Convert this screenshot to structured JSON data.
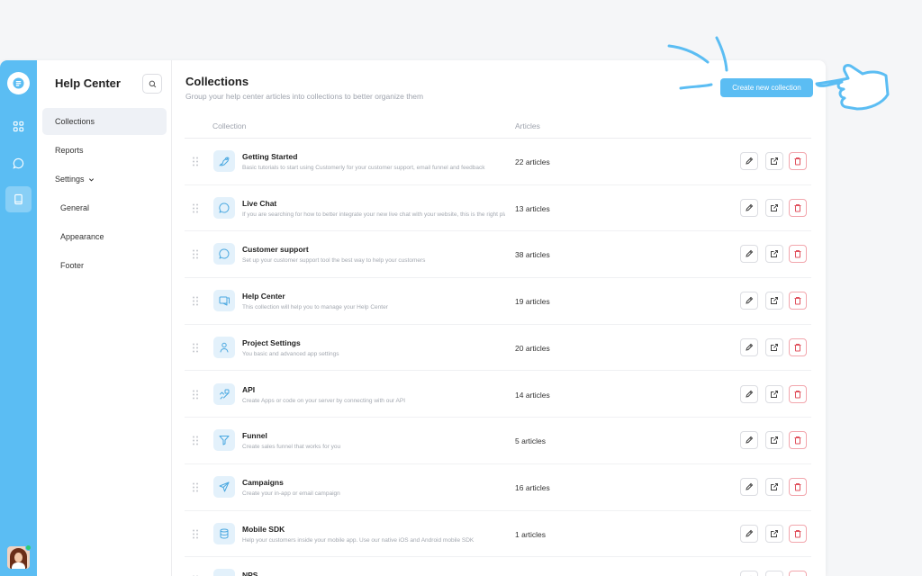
{
  "app": {
    "rail": [
      {
        "name": "logo-icon"
      },
      {
        "name": "grid-icon"
      },
      {
        "name": "chat-icon"
      },
      {
        "name": "book-icon",
        "active": true
      }
    ],
    "accent": "#5bbdf3",
    "danger": "#e0525e"
  },
  "sidebar": {
    "title": "Help Center",
    "search_icon": "search-icon",
    "items": [
      {
        "label": "Collections",
        "active": true
      },
      {
        "label": "Reports"
      },
      {
        "label": "Settings"
      },
      {
        "label": "General"
      },
      {
        "label": "Appearance"
      },
      {
        "label": "Footer"
      }
    ]
  },
  "main": {
    "title": "Collections",
    "subtitle": "Group your help center articles into collections to better organize them",
    "create_button": "Create new collection",
    "columns": {
      "collection": "Collection",
      "articles": "Articles"
    },
    "rows": [
      {
        "name": "Getting Started",
        "desc": "Basic tutorials to start using Customerly for your customer support, email funnel and feedback",
        "count": "22 articles",
        "icon": "rocket-icon"
      },
      {
        "name": "Live Chat",
        "desc": "If you are searching for how to better integrate your new live chat with your website, this is the right place",
        "count": "13 articles",
        "icon": "chat-bubble-icon"
      },
      {
        "name": "Customer support",
        "desc": "Set up your customer support tool the best way to help your customers",
        "count": "38 articles",
        "icon": "chat-bubble-icon"
      },
      {
        "name": "Help Center",
        "desc": "This collection will help you to manage your Help Center",
        "count": "19 articles",
        "icon": "help-center-icon"
      },
      {
        "name": "Project Settings",
        "desc": "You basic and advanced app settings",
        "count": "20 articles",
        "icon": "settings-person-icon"
      },
      {
        "name": "API",
        "desc": "Create Apps or code on your server by connecting with our API",
        "count": "14 articles",
        "icon": "api-icon"
      },
      {
        "name": "Funnel",
        "desc": "Create sales funnel that works for you",
        "count": "5 articles",
        "icon": "funnel-icon"
      },
      {
        "name": "Campaigns",
        "desc": "Create your in-app or email campaign",
        "count": "16 articles",
        "icon": "paper-plane-icon"
      },
      {
        "name": "Mobile SDK",
        "desc": "Help your customers inside your mobile app. Use our native iOS and Android mobile SDK",
        "count": "1 articles",
        "icon": "database-icon"
      },
      {
        "name": "NPS",
        "desc": "",
        "count": "",
        "icon": "nps-icon"
      }
    ]
  }
}
